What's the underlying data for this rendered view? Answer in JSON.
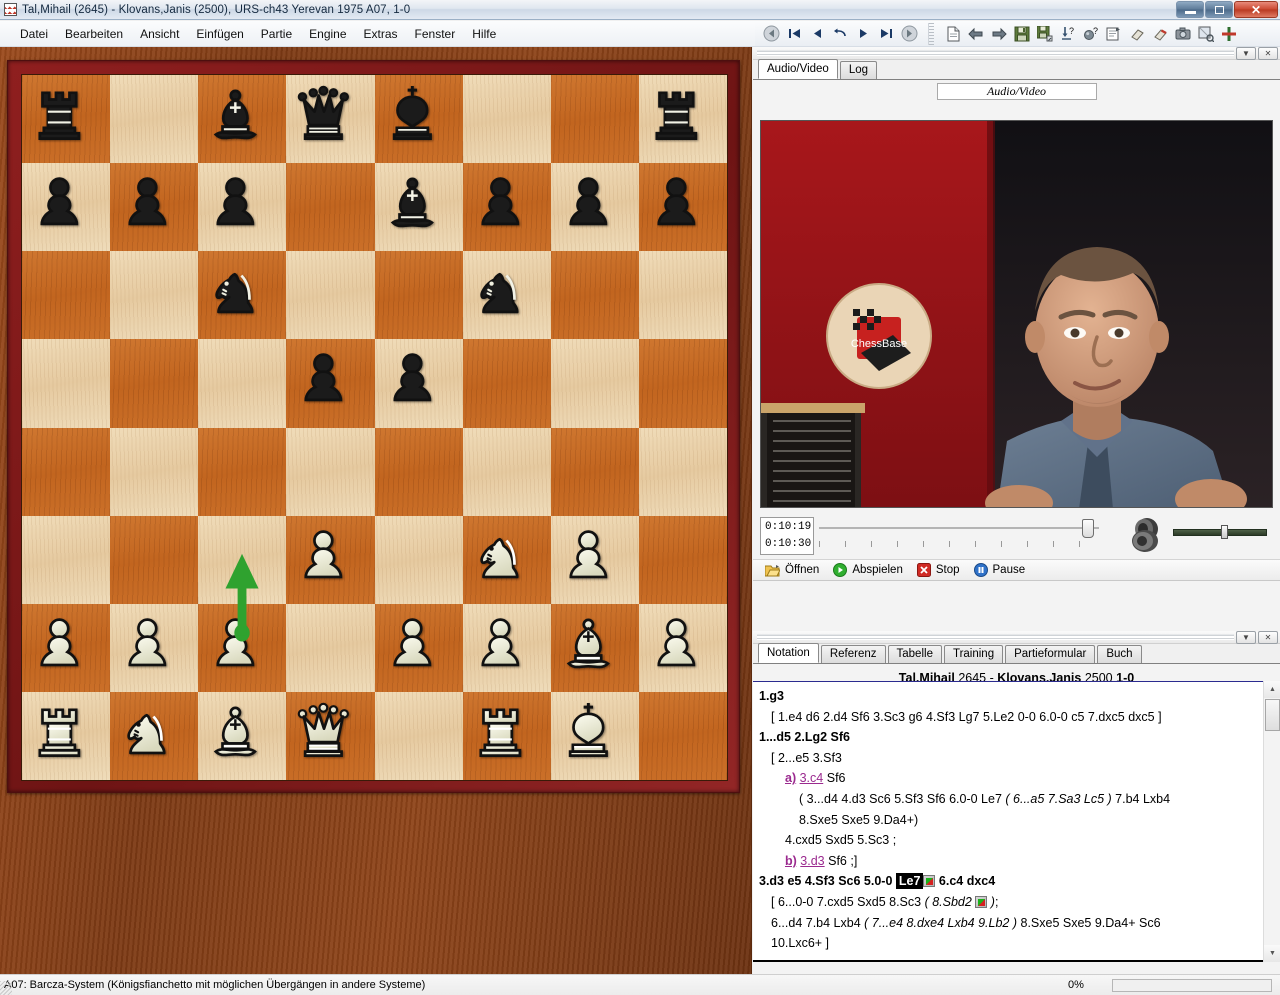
{
  "window": {
    "title": "Tal,Mihail (2645) - Klovans,Janis (2500), URS-ch43 Yerevan 1975  A07, 1-0",
    "icon": "chessbase-app-icon",
    "minimize_label": "Minimieren",
    "maximize_label": "Maximieren",
    "close_label": "Schließen"
  },
  "menubar": {
    "items": [
      {
        "label": "Datei"
      },
      {
        "label": "Bearbeiten"
      },
      {
        "label": "Ansicht"
      },
      {
        "label": "Einfügen"
      },
      {
        "label": "Partie"
      },
      {
        "label": "Engine"
      },
      {
        "label": "Extras"
      },
      {
        "label": "Fenster"
      },
      {
        "label": "Hilfe"
      }
    ]
  },
  "toolbar": {
    "nav_group": [
      {
        "name": "back-icon"
      },
      {
        "name": "first-move-icon"
      },
      {
        "name": "previous-move-icon"
      },
      {
        "name": "takeback-icon"
      },
      {
        "name": "next-move-icon"
      },
      {
        "name": "last-move-icon"
      },
      {
        "name": "forward-icon"
      }
    ],
    "file_group": [
      {
        "name": "new-game-icon"
      },
      {
        "name": "previous-game-icon"
      },
      {
        "name": "next-game-icon"
      },
      {
        "name": "save-game-icon"
      },
      {
        "name": "save-as-icon"
      },
      {
        "name": "replace-game-icon"
      },
      {
        "name": "help-question-icon"
      },
      {
        "name": "game-data-icon"
      },
      {
        "name": "erase-annotation-icon"
      },
      {
        "name": "erase-variation-icon"
      },
      {
        "name": "snapshot-icon"
      },
      {
        "name": "copy-position-icon"
      },
      {
        "name": "add-cross-icon"
      }
    ]
  },
  "board": {
    "flipped": false,
    "light_square_color": "#e8cda5",
    "dark_square_color": "#c56a28",
    "frame_color": "#7d1a1a",
    "arrow": {
      "from": "c2",
      "to": "c3",
      "color": "#2fa22f"
    },
    "position_fen": "r1bqk2r/ppp1bppp/2n2n2/3pp3/8/3P1NP1/PPP1PPBP/RNBQ1RK1",
    "pieces": [
      {
        "square": "a8",
        "piece": "black-rook"
      },
      {
        "square": "c8",
        "piece": "black-bishop"
      },
      {
        "square": "d8",
        "piece": "black-queen"
      },
      {
        "square": "e8",
        "piece": "black-king"
      },
      {
        "square": "h8",
        "piece": "black-rook"
      },
      {
        "square": "a7",
        "piece": "black-pawn"
      },
      {
        "square": "b7",
        "piece": "black-pawn"
      },
      {
        "square": "c7",
        "piece": "black-pawn"
      },
      {
        "square": "e7",
        "piece": "black-bishop"
      },
      {
        "square": "f7",
        "piece": "black-pawn"
      },
      {
        "square": "g7",
        "piece": "black-pawn"
      },
      {
        "square": "h7",
        "piece": "black-pawn"
      },
      {
        "square": "c6",
        "piece": "black-knight"
      },
      {
        "square": "f6",
        "piece": "black-knight"
      },
      {
        "square": "d5",
        "piece": "black-pawn"
      },
      {
        "square": "e5",
        "piece": "black-pawn"
      },
      {
        "square": "d3",
        "piece": "white-pawn"
      },
      {
        "square": "f3",
        "piece": "white-knight"
      },
      {
        "square": "g3",
        "piece": "white-pawn"
      },
      {
        "square": "a2",
        "piece": "white-pawn"
      },
      {
        "square": "b2",
        "piece": "white-pawn"
      },
      {
        "square": "c2",
        "piece": "white-pawn"
      },
      {
        "square": "e2",
        "piece": "white-pawn"
      },
      {
        "square": "f2",
        "piece": "white-pawn"
      },
      {
        "square": "g2",
        "piece": "white-bishop"
      },
      {
        "square": "h2",
        "piece": "white-pawn"
      },
      {
        "square": "a1",
        "piece": "white-rook"
      },
      {
        "square": "b1",
        "piece": "white-knight"
      },
      {
        "square": "c1",
        "piece": "white-bishop"
      },
      {
        "square": "d1",
        "piece": "white-queen"
      },
      {
        "square": "f1",
        "piece": "white-rook"
      },
      {
        "square": "g1",
        "piece": "white-king"
      }
    ]
  },
  "av_panel": {
    "tabs": [
      {
        "label": "Audio/Video",
        "active": true
      },
      {
        "label": "Log",
        "active": false
      }
    ],
    "caption": "Audio/Video",
    "video_alt": "ChessBase video lecture – presenter in front of red ChessBase banner",
    "time_current": "0:10:19",
    "time_total": "0:10:30",
    "seek_position_pct": 94,
    "volume_pct": 52,
    "buttons": [
      {
        "label": "Öffnen",
        "icon": "open-folder-icon"
      },
      {
        "label": "Abspielen",
        "icon": "play-icon"
      },
      {
        "label": "Stop",
        "icon": "stop-icon"
      },
      {
        "label": "Pause",
        "icon": "pause-icon"
      }
    ],
    "panel_menu_label": "▼",
    "panel_close_label": "✕"
  },
  "notation_panel": {
    "tabs": [
      {
        "label": "Notation",
        "active": true
      },
      {
        "label": "Referenz",
        "active": false
      },
      {
        "label": "Tabelle",
        "active": false
      },
      {
        "label": "Training",
        "active": false
      },
      {
        "label": "Partieformular",
        "active": false
      },
      {
        "label": "Buch",
        "active": false
      }
    ],
    "panel_menu_label": "▼",
    "panel_close_label": "✕",
    "header": {
      "white": "Tal,Mihail",
      "white_elo": "2645",
      "dash": "-",
      "black": "Klovans,Janis",
      "black_elo": "2500",
      "result": "1-0",
      "eco": "A07",
      "event": "URS-ch43 Yerevan 1975"
    },
    "lines": [
      {
        "indent": 0,
        "style": "main",
        "text": "1.g3"
      },
      {
        "indent": 1,
        "style": "var",
        "text": "[ 1.e4  d6  2.d4  Sf6  3.Sc3  g6  4.Sf3  Lg7  5.Le2  0-0  6.0-0  c5  7.dxc5  dxc5 ]"
      },
      {
        "indent": 0,
        "style": "main",
        "text": "1...d5  2.Lg2  Sf6"
      },
      {
        "indent": 1,
        "style": "var",
        "text": "[ 2...e5  3.Sf3"
      },
      {
        "indent": 2,
        "style": "marker",
        "text": "a) 3.c4  Sf6"
      },
      {
        "indent": 3,
        "style": "var",
        "text": "( 3...d4  4.d3  Sc6  5.Sf3  Sf6  6.0-0  Le7  ( 6...a5  7.Sa3  Lc5 ) 7.b4  Lxb4"
      },
      {
        "indent": 3,
        "style": "var",
        "text": "8.Sxe5  Sxe5  9.Da4+)"
      },
      {
        "indent": 2,
        "style": "var",
        "text": "4.cxd5  Sxd5  5.Sc3 ;"
      },
      {
        "indent": 2,
        "style": "marker",
        "text": "b) 3.d3  Sf6 ;]"
      },
      {
        "indent": 0,
        "style": "current",
        "text": "3.d3  e5  4.Sf3  Sc6  5.0-0  Le7  6.c4  dxc4"
      },
      {
        "indent": 1,
        "style": "var",
        "text": "[ 6...0-0  7.cxd5  Sxd5  8.Sc3  ( 8.Sbd2  );"
      },
      {
        "indent": 1,
        "style": "var",
        "text": "6...d4  7.b4  Lxb4  ( 7...e4  8.dxe4  Lxb4  9.Lb2 ) 8.Sxe5  Sxe5  9.Da4+  Sc6"
      },
      {
        "indent": 1,
        "style": "var",
        "text": "10.Lxc6+ ]"
      }
    ],
    "current_move": "Le7",
    "scroll_up_label": "▲",
    "scroll_down_label": "▼"
  },
  "statusbar": {
    "text": "A07: Barcza-System (Königsfianchetto mit möglichen Übergängen in andere Systeme)",
    "percent": "0%",
    "progress_value": 0
  }
}
